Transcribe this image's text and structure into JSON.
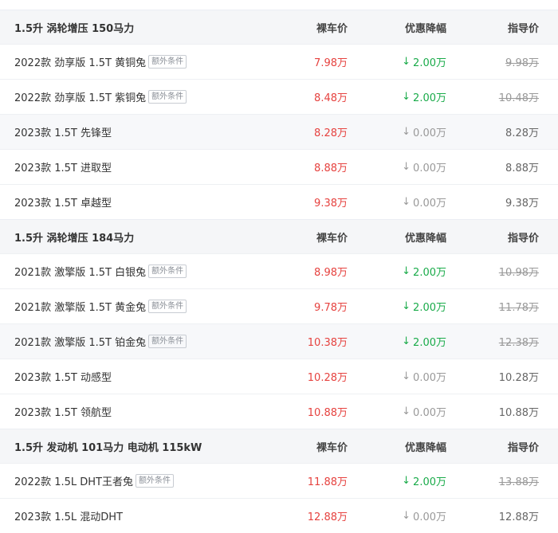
{
  "columns": {
    "price": "裸车价",
    "discount": "优惠降幅",
    "guide": "指导价"
  },
  "colors": {
    "price": "#e6423f",
    "discount_active": "#1aab4a",
    "discount_inactive": "#999999"
  },
  "groups": [
    {
      "title": "1.5升 涡轮增压 150马力",
      "rows": [
        {
          "name": "2022款 劲享版 1.5T 黄铜兔",
          "tag": "额外条件",
          "price": "7.98万",
          "discount": "2.00万",
          "guide": "9.98万"
        },
        {
          "name": "2022款 劲享版 1.5T 紫铜兔",
          "tag": "额外条件",
          "price": "8.48万",
          "discount": "2.00万",
          "guide": "10.48万"
        },
        {
          "name": "2023款 1.5T 先锋型",
          "tag": "",
          "price": "8.28万",
          "discount": "0.00万",
          "guide": "8.28万"
        },
        {
          "name": "2023款 1.5T 进取型",
          "tag": "",
          "price": "8.88万",
          "discount": "0.00万",
          "guide": "8.88万"
        },
        {
          "name": "2023款 1.5T 卓越型",
          "tag": "",
          "price": "9.38万",
          "discount": "0.00万",
          "guide": "9.38万"
        }
      ]
    },
    {
      "title": "1.5升 涡轮增压 184马力",
      "rows": [
        {
          "name": "2021款 激擎版 1.5T 白银兔",
          "tag": "额外条件",
          "price": "8.98万",
          "discount": "2.00万",
          "guide": "10.98万"
        },
        {
          "name": "2021款 激擎版 1.5T 黄金兔",
          "tag": "额外条件",
          "price": "9.78万",
          "discount": "2.00万",
          "guide": "11.78万"
        },
        {
          "name": "2021款 激擎版 1.5T 铂金兔",
          "tag": "额外条件",
          "price": "10.38万",
          "discount": "2.00万",
          "guide": "12.38万"
        },
        {
          "name": "2023款 1.5T 动感型",
          "tag": "",
          "price": "10.28万",
          "discount": "0.00万",
          "guide": "10.28万"
        },
        {
          "name": "2023款 1.5T 领航型",
          "tag": "",
          "price": "10.88万",
          "discount": "0.00万",
          "guide": "10.88万"
        }
      ]
    },
    {
      "title": "1.5升 发动机 101马力 电动机 115kW",
      "rows": [
        {
          "name": "2022款 1.5L DHT王者兔",
          "tag": "额外条件",
          "price": "11.88万",
          "discount": "2.00万",
          "guide": "13.88万"
        },
        {
          "name": "2023款 1.5L 混动DHT",
          "tag": "",
          "price": "12.88万",
          "discount": "0.00万",
          "guide": "12.88万"
        }
      ]
    }
  ]
}
